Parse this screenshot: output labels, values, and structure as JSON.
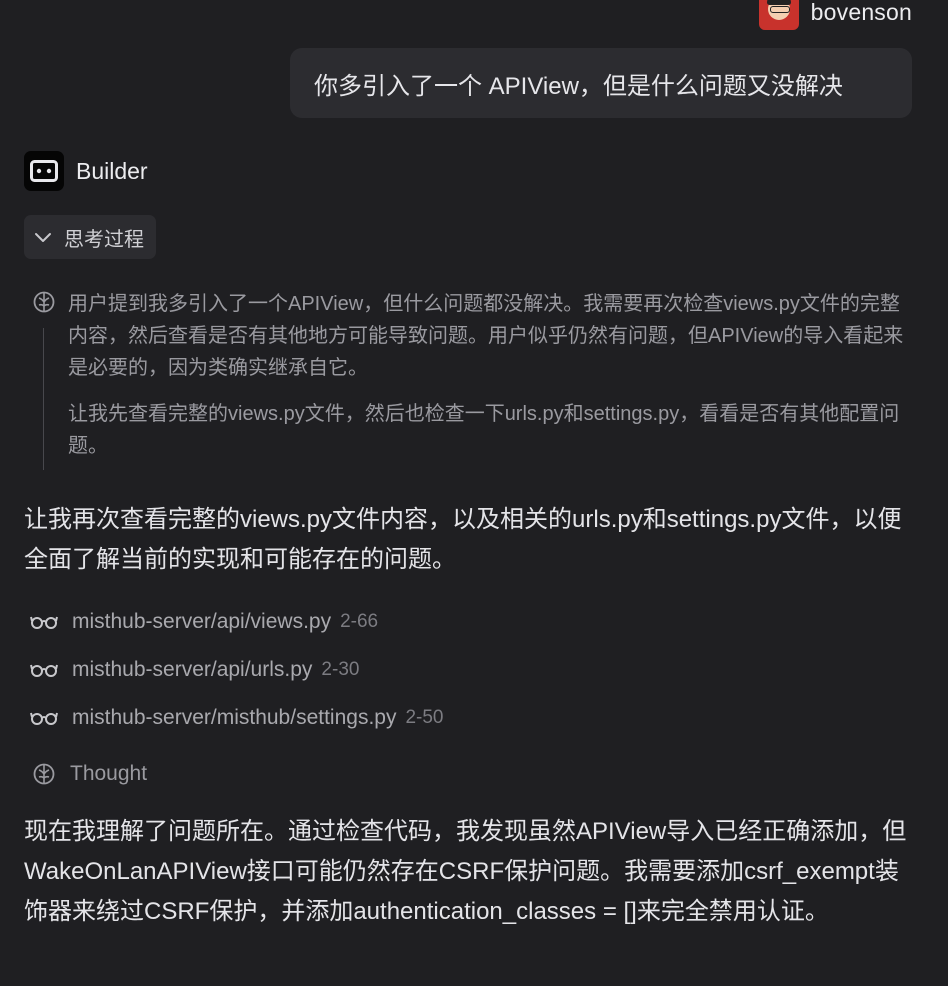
{
  "user": {
    "name": "bovenson",
    "message": "你多引入了一个 APIView，但是什么问题又没解决"
  },
  "assistant": {
    "name": "Builder",
    "thinking_toggle_label": "思考过程",
    "thinking_paragraphs": [
      "用户提到我多引入了一个APIView，但什么问题都没解决。我需要再次检查views.py文件的完整内容，然后查看是否有其他地方可能导致问题。用户似乎仍然有问题，但APIView的导入看起来是必要的，因为类确实继承自它。",
      "让我先查看完整的views.py文件，然后也检查一下urls.py和settings.py，看看是否有其他配置问题。"
    ],
    "intro_text": "让我再次查看完整的views.py文件内容，以及相关的urls.py和settings.py文件，以便全面了解当前的实现和可能存在的问题。",
    "files": [
      {
        "path": "misthub-server/api/views.py",
        "range": "2-66",
        "icon": "glasses-icon"
      },
      {
        "path": "misthub-server/api/urls.py",
        "range": "2-30",
        "icon": "glasses-icon"
      },
      {
        "path": "misthub-server/misthub/settings.py",
        "range": "2-50",
        "icon": "glasses-icon"
      }
    ],
    "thought_label": "Thought",
    "conclusion_text": "现在我理解了问题所在。通过检查代码，我发现虽然APIView导入已经正确添加，但WakeOnLanAPIView接口可能仍然存在CSRF保护问题。我需要添加csrf_exempt装饰器来绕过CSRF保护，并添加authentication_classes = []来完全禁用认证。"
  },
  "colors": {
    "background": "#1f1f22",
    "bubble": "#2c2c30",
    "avatar": "#c8322c"
  }
}
